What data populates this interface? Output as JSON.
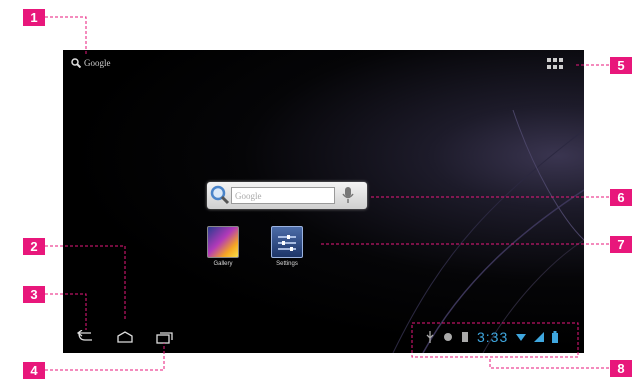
{
  "colors": {
    "accent": "#e8177b",
    "clock": "#3fa7df",
    "background": "#000000"
  },
  "google_search_label": "Google",
  "search_widget": {
    "placeholder": "Google"
  },
  "apps": [
    {
      "label": "Gallery",
      "icon": "gallery-icon"
    },
    {
      "label": "Settings",
      "icon": "settings-icon"
    }
  ],
  "status_bar": {
    "time": "3:33"
  },
  "callouts": [
    "1",
    "2",
    "3",
    "4",
    "5",
    "6",
    "7",
    "8"
  ]
}
